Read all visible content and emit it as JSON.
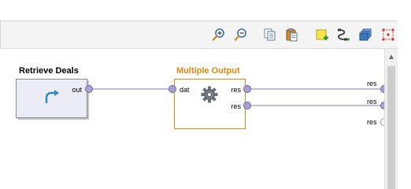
{
  "toolbar": {
    "icons": [
      "zoom-in-icon",
      "zoom-out-icon",
      "copy-icon",
      "paste-icon",
      "add-note-icon",
      "auto-wire-icon",
      "arrange-icon",
      "fit-selection-icon"
    ]
  },
  "canvas": {
    "operators": [
      {
        "title": "Retrieve Deals",
        "ports_out": [
          "out"
        ]
      },
      {
        "title": "Multiple Output",
        "ports_in": [
          "dat"
        ],
        "ports_out": [
          "res",
          "res"
        ]
      }
    ],
    "process_results": [
      "res",
      "res",
      "res"
    ]
  },
  "colors": {
    "accent_orange": "#e6870c",
    "port_purple": "#a99fd0",
    "wire": "#9a93c6",
    "operator_bg": "#ececf6"
  }
}
